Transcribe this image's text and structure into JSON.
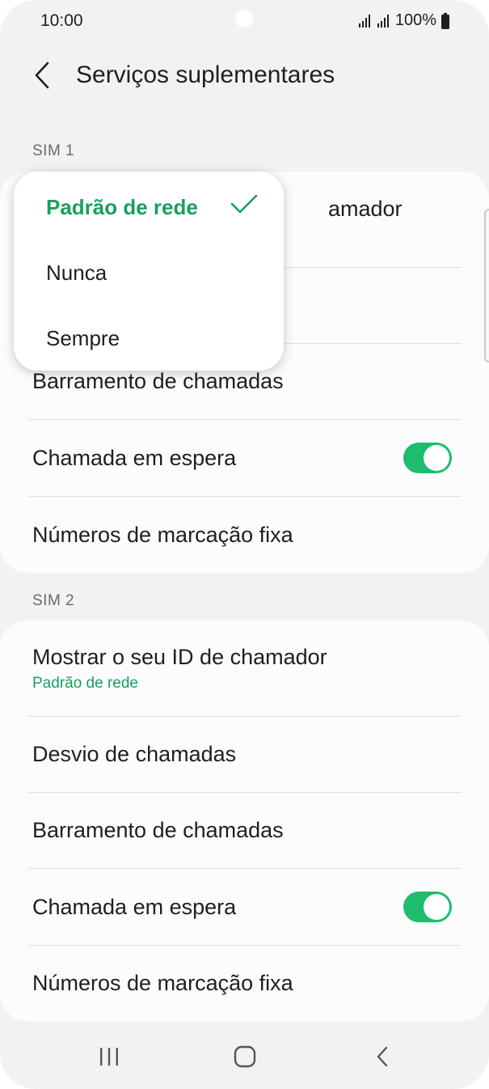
{
  "status_bar": {
    "time": "10:00",
    "battery": "100%",
    "icons": [
      "signal-icon",
      "signal-icon",
      "battery-icon"
    ]
  },
  "header": {
    "title": "Serviços suplementares",
    "back_icon": "chevron-left-icon"
  },
  "sim1": {
    "label": "SIM 1",
    "rows": [
      {
        "title": "Mostrar o seu ID de chamador",
        "visible_fragment": "amador"
      },
      {
        "title": ""
      },
      {
        "title": "Barramento de chamadas"
      },
      {
        "title": "Chamada em espera",
        "toggle_on": true
      },
      {
        "title": "Números de marcação fixa"
      }
    ]
  },
  "dropdown": {
    "options": [
      {
        "label": "Padrão de rede",
        "selected": true
      },
      {
        "label": "Nunca",
        "selected": false
      },
      {
        "label": "Sempre",
        "selected": false
      }
    ],
    "check_icon": "check-icon"
  },
  "sim2": {
    "label": "SIM 2",
    "rows": [
      {
        "title": "Mostrar o seu ID de chamador",
        "subtitle": "Padrão de rede"
      },
      {
        "title": "Desvio de chamadas"
      },
      {
        "title": "Barramento de chamadas"
      },
      {
        "title": "Chamada em espera",
        "toggle_on": true
      },
      {
        "title": "Números de marcação fixa"
      }
    ]
  },
  "nav_bar": {
    "icons": [
      "recent-apps-icon",
      "home-icon",
      "back-icon"
    ]
  },
  "colors": {
    "accent": "#1a9e61",
    "toggle_on": "#1ebd6e",
    "background": "#f2f2f2",
    "card": "#fcfcfc"
  }
}
